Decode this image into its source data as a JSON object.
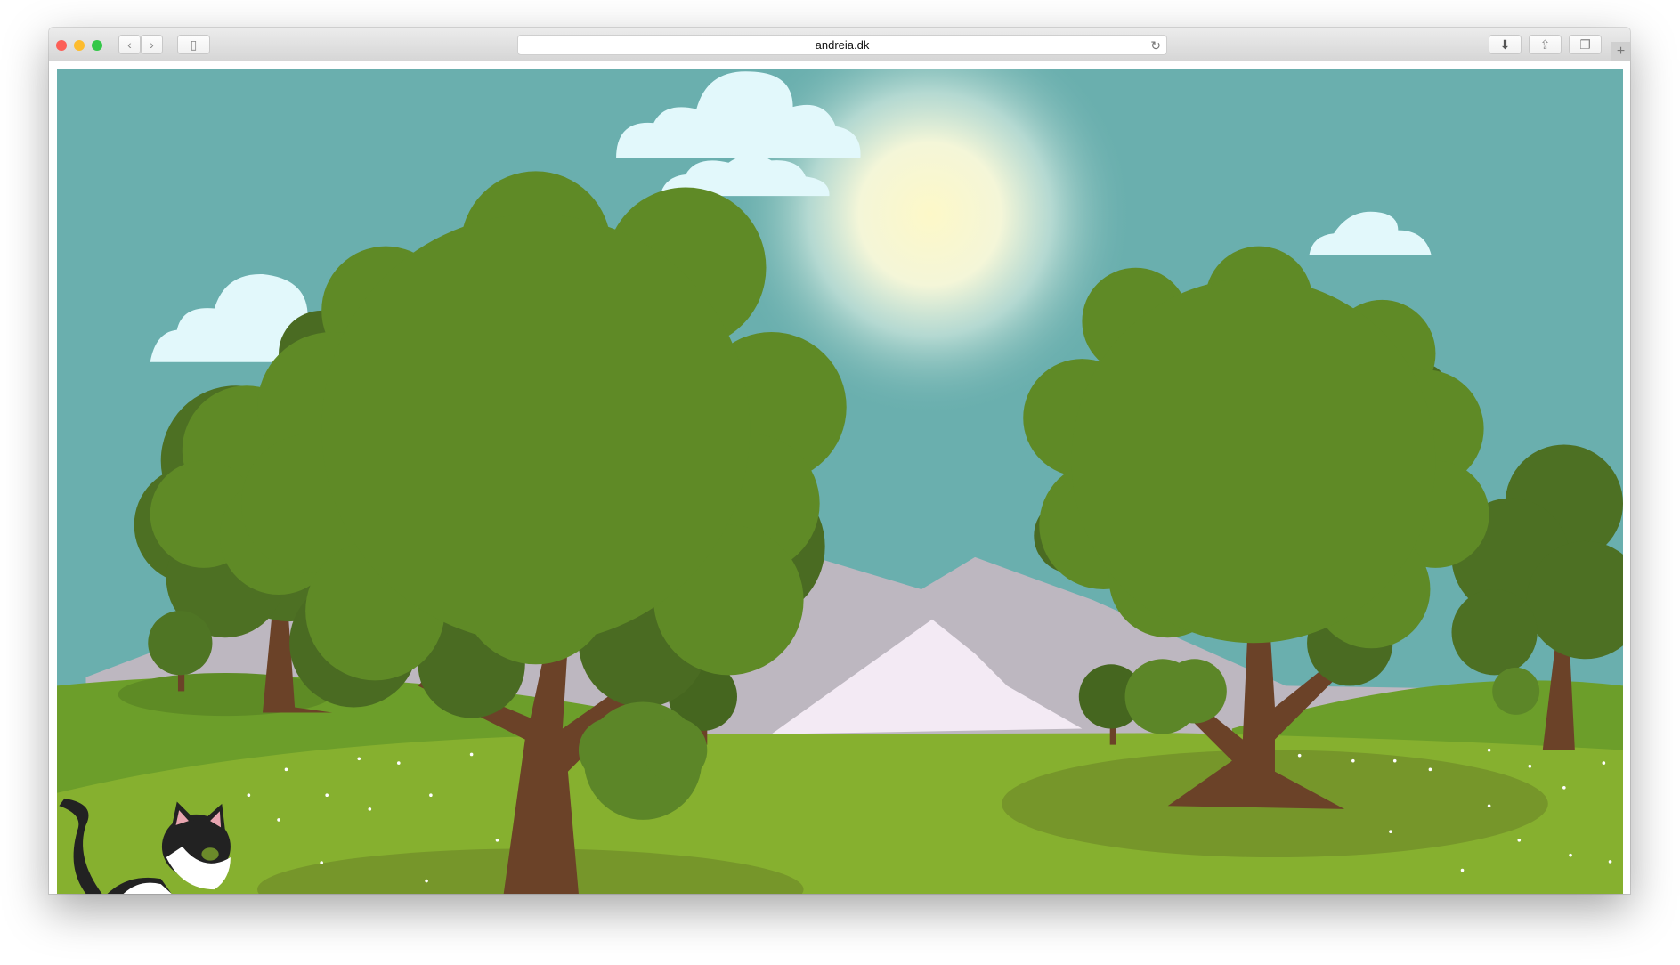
{
  "browser": {
    "url": "andreia.dk",
    "icons": [
      "close-light",
      "minimize-light",
      "zoom-light",
      "back-icon",
      "forward-icon",
      "sidebar-icon",
      "reload-icon",
      "download-icon",
      "share-icon",
      "tabs-icon",
      "new-tab-icon"
    ]
  },
  "colors": {
    "sky": "#6aafae",
    "grass": "#7fb02e",
    "tree": "#5f8a26",
    "trunk": "#6b4228",
    "mountain": "#bdb7c0"
  }
}
